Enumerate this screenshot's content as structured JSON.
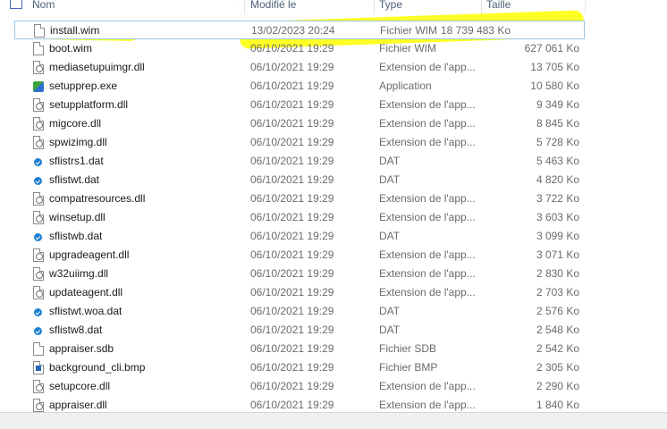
{
  "columns": {
    "name": "Nom",
    "modified": "Modifié le",
    "type": "Type",
    "size": "Taille"
  },
  "files": [
    {
      "name": "install.wim",
      "date": "13/02/2023 20:24",
      "type": "Fichier WIM",
      "size": "18 739 483 Ko",
      "icon": "document-icon",
      "selected": true
    },
    {
      "name": "boot.wim",
      "date": "06/10/2021 19:29",
      "type": "Fichier WIM",
      "size": "627 061 Ko",
      "icon": "document-icon"
    },
    {
      "name": "mediasetupuimgr.dll",
      "date": "06/10/2021 19:29",
      "type": "Extension de l'app...",
      "size": "13 705 Ko",
      "icon": "dll-icon"
    },
    {
      "name": "setupprep.exe",
      "date": "06/10/2021 19:29",
      "type": "Application",
      "size": "10 580 Ko",
      "icon": "exe-icon"
    },
    {
      "name": "setupplatform.dll",
      "date": "06/10/2021 19:29",
      "type": "Extension de l'app...",
      "size": "9 349 Ko",
      "icon": "dll-icon"
    },
    {
      "name": "migcore.dll",
      "date": "06/10/2021 19:29",
      "type": "Extension de l'app...",
      "size": "8 845 Ko",
      "icon": "dll-icon"
    },
    {
      "name": "spwizimg.dll",
      "date": "06/10/2021 19:29",
      "type": "Extension de l'app...",
      "size": "5 728 Ko",
      "icon": "dll-icon"
    },
    {
      "name": "sflistrs1.dat",
      "date": "06/10/2021 19:29",
      "type": "DAT",
      "size": "5 463 Ko",
      "icon": "dat-icon"
    },
    {
      "name": "sflistwt.dat",
      "date": "06/10/2021 19:29",
      "type": "DAT",
      "size": "4 820 Ko",
      "icon": "dat-icon"
    },
    {
      "name": "compatresources.dll",
      "date": "06/10/2021 19:29",
      "type": "Extension de l'app...",
      "size": "3 722 Ko",
      "icon": "dll-icon"
    },
    {
      "name": "winsetup.dll",
      "date": "06/10/2021 19:29",
      "type": "Extension de l'app...",
      "size": "3 603 Ko",
      "icon": "dll-icon"
    },
    {
      "name": "sflistwb.dat",
      "date": "06/10/2021 19:29",
      "type": "DAT",
      "size": "3 099 Ko",
      "icon": "dat-icon"
    },
    {
      "name": "upgradeagent.dll",
      "date": "06/10/2021 19:29",
      "type": "Extension de l'app...",
      "size": "3 071 Ko",
      "icon": "dll-icon"
    },
    {
      "name": "w32uiimg.dll",
      "date": "06/10/2021 19:29",
      "type": "Extension de l'app...",
      "size": "2 830 Ko",
      "icon": "dll-icon"
    },
    {
      "name": "updateagent.dll",
      "date": "06/10/2021 19:29",
      "type": "Extension de l'app...",
      "size": "2 703 Ko",
      "icon": "dll-icon"
    },
    {
      "name": "sflistwt.woa.dat",
      "date": "06/10/2021 19:29",
      "type": "DAT",
      "size": "2 576 Ko",
      "icon": "dat-icon"
    },
    {
      "name": "sflistw8.dat",
      "date": "06/10/2021 19:29",
      "type": "DAT",
      "size": "2 548 Ko",
      "icon": "dat-icon"
    },
    {
      "name": "appraiser.sdb",
      "date": "06/10/2021 19:29",
      "type": "Fichier SDB",
      "size": "2 542 Ko",
      "icon": "document-icon"
    },
    {
      "name": "background_cli.bmp",
      "date": "06/10/2021 19:29",
      "type": "Fichier BMP",
      "size": "2 305 Ko",
      "icon": "bmp-icon"
    },
    {
      "name": "setupcore.dll",
      "date": "06/10/2021 19:29",
      "type": "Extension de l'app...",
      "size": "2 290 Ko",
      "icon": "dll-icon"
    },
    {
      "name": "appraiser.dll",
      "date": "06/10/2021 19:29",
      "type": "Extension de l'app...",
      "size": "1 840 Ko",
      "icon": "dll-icon"
    }
  ],
  "colors": {
    "highlight": "#ffff00",
    "header_text": "#4c607a",
    "selection_border": "#99c6ea"
  }
}
